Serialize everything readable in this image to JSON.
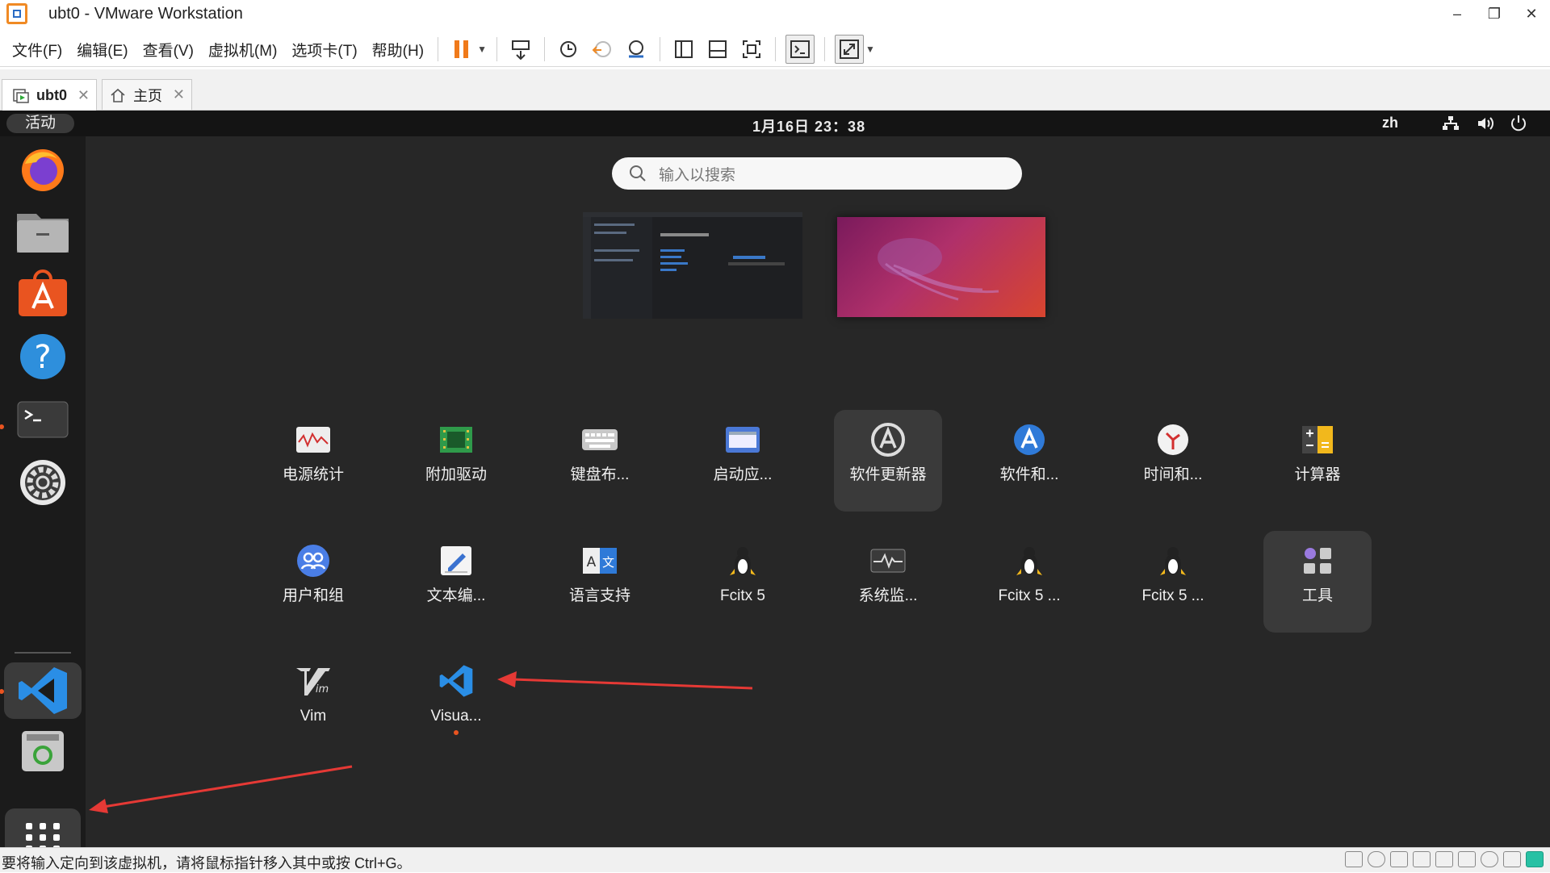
{
  "window": {
    "title": "ubt0 - VMware Workstation",
    "controls": [
      "–",
      "❐",
      "✕"
    ]
  },
  "menu": {
    "items": [
      "文件(F)",
      "编辑(E)",
      "查看(V)",
      "虚拟机(M)",
      "选项卡(T)",
      "帮助(H)"
    ]
  },
  "toolbar": {
    "icons": [
      "pause-icon",
      "send-keys-icon",
      "snapshot-icon",
      "revert-snapshot-icon",
      "snapshot-manager-icon",
      "library-icon",
      "thumbnail-icon",
      "fullscreen-icon",
      "console-icon",
      "stretch-icon"
    ]
  },
  "tabs": [
    {
      "label": "ubt0",
      "active": true
    },
    {
      "label": "主页",
      "active": false
    }
  ],
  "guest": {
    "activities": "活动",
    "clock": "1月16日  23：38",
    "lang": "zh",
    "search_placeholder": "输入以搜索",
    "dock": [
      "firefox-icon",
      "files-icon",
      "app-center-icon",
      "help-icon",
      "terminal-icon",
      "settings-icon",
      "vscode-icon",
      "trash-icon"
    ],
    "apps": [
      {
        "label": "电源统计"
      },
      {
        "label": "附加驱动"
      },
      {
        "label": "键盘布..."
      },
      {
        "label": "启动应..."
      },
      {
        "label": "软件更新器"
      },
      {
        "label": "软件和..."
      },
      {
        "label": "时间和..."
      },
      {
        "label": "计算器"
      },
      {
        "label": "用户和组"
      },
      {
        "label": "文本编..."
      },
      {
        "label": "语言支持"
      },
      {
        "label": "Fcitx 5"
      },
      {
        "label": "系统监..."
      },
      {
        "label": "Fcitx 5 ..."
      },
      {
        "label": "Fcitx 5 ..."
      },
      {
        "label": "工具"
      },
      {
        "label": "Vim"
      },
      {
        "label": "Visua..."
      }
    ]
  },
  "status": {
    "text": "要将输入定向到该虚拟机，请将鼠标指针移入其中或按 Ctrl+G。"
  },
  "colors": {
    "accent": "#e95420",
    "arrow": "#e53935"
  }
}
